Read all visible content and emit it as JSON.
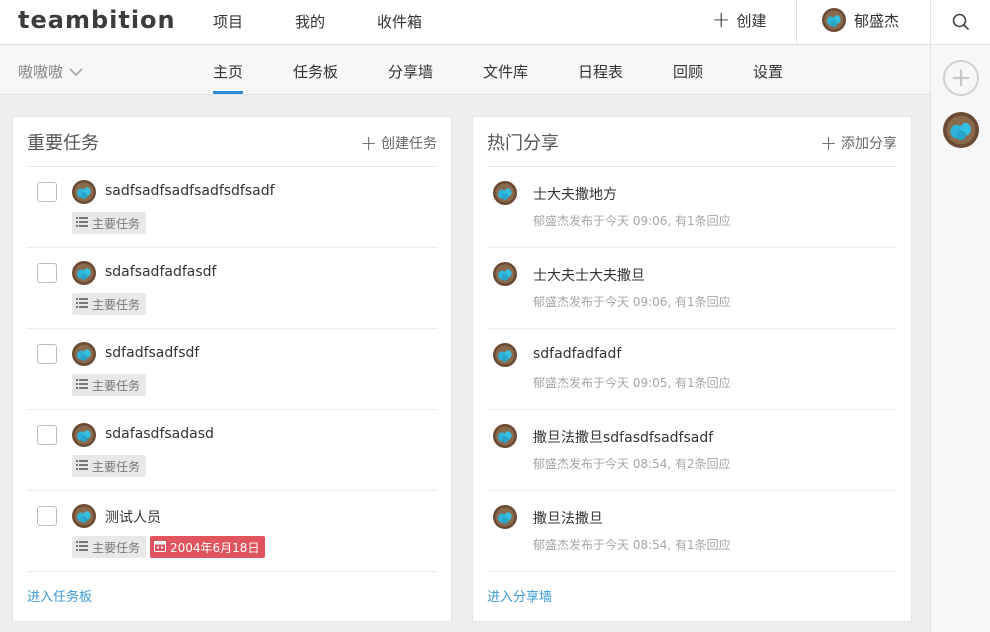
{
  "app": {
    "logo": "teambition"
  },
  "topnav": {
    "items": [
      "项目",
      "我的",
      "收件箱"
    ],
    "create_label": "创建",
    "user_name": "郁盛杰"
  },
  "project": {
    "name": "嗷嗷嗷"
  },
  "subnav": {
    "tabs": [
      "主页",
      "任务板",
      "分享墙",
      "文件库",
      "日程表",
      "回顾",
      "设置"
    ],
    "active": "主页"
  },
  "tasks_panel": {
    "title": "重要任务",
    "action_label": "创建任务",
    "tag_label": "主要任务",
    "items": [
      {
        "title": "sadfsadfsadfsadfsdfsadf",
        "due": ""
      },
      {
        "title": "sdafsadfadfasdf",
        "due": ""
      },
      {
        "title": "sdfadfsadfsdf",
        "due": ""
      },
      {
        "title": "sdafasdfsadasd",
        "due": ""
      },
      {
        "title": "测试人员",
        "due": "2004年6月18日"
      }
    ],
    "footer_link": "进入任务板"
  },
  "share_panel": {
    "title": "热门分享",
    "action_label": "添加分享",
    "items": [
      {
        "title": "士大夫撒地方",
        "meta": "郁盛杰发布于今天 09:06, 有1条回应"
      },
      {
        "title": "士大夫士大夫撒旦",
        "meta": "郁盛杰发布于今天 09:06, 有1条回应"
      },
      {
        "title": "sdfadfadfadf",
        "meta": "郁盛杰发布于今天 09:05, 有1条回应"
      },
      {
        "title": "撒旦法撒旦sdfasdfsadfsadf",
        "meta": "郁盛杰发布于今天 08:54, 有2条回应"
      },
      {
        "title": "撒旦法撒旦",
        "meta": "郁盛杰发布于今天 08:54, 有1条回应"
      }
    ],
    "footer_link": "进入分享墙"
  },
  "colors": {
    "accent": "#2b8cd6",
    "link": "#3a9bd5",
    "due_red": "#e0545e"
  },
  "icons": {
    "search": "search-icon",
    "add": "plus-icon",
    "avatar": "avatar-eggs",
    "list": "list-icon",
    "calendar": "calendar-icon"
  }
}
